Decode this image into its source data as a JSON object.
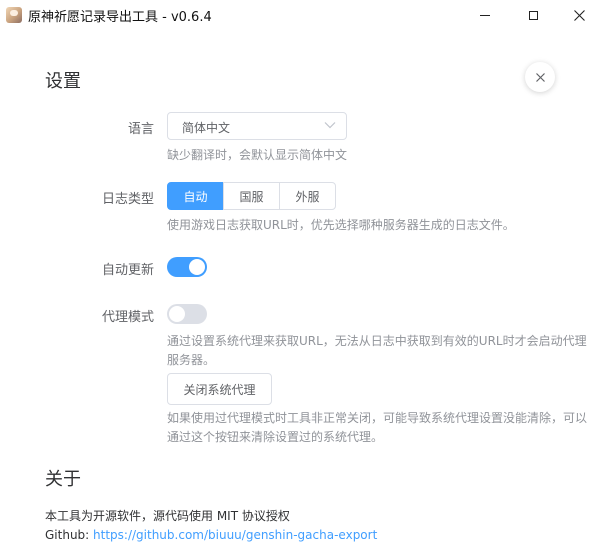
{
  "window": {
    "title": "原神祈愿记录导出工具 - v0.6.4"
  },
  "settings": {
    "title": "设置",
    "language": {
      "label": "语言",
      "value": "简体中文",
      "hint": "缺少翻译时，会默认显示简体中文"
    },
    "log_type": {
      "label": "日志类型",
      "options": [
        "自动",
        "国服",
        "外服"
      ],
      "selected": "自动",
      "hint": "使用游戏日志获取URL时，优先选择哪种服务器生成的日志文件。"
    },
    "auto_update": {
      "label": "自动更新",
      "enabled": true
    },
    "proxy_mode": {
      "label": "代理模式",
      "enabled": false,
      "hint": "通过设置系统代理来获取URL，无法从日志中获取到有效的URL时才会启动代理服务器。"
    },
    "close_proxy": {
      "button_label": "关闭系统代理",
      "hint": "如果使用过代理模式时工具非正常关闭，可能导致系统代理设置没能清除，可以通过这个按钮来清除设置过的系统代理。"
    }
  },
  "about": {
    "title": "关于",
    "license": "本工具为开源软件，源代码使用 MIT 协议授权",
    "github_label": "Github: ",
    "github_url": "https://github.com/biuuu/genshin-gacha-export"
  },
  "colors": {
    "primary": "#409eff",
    "border": "#dcdfe6",
    "hint": "#909399"
  }
}
